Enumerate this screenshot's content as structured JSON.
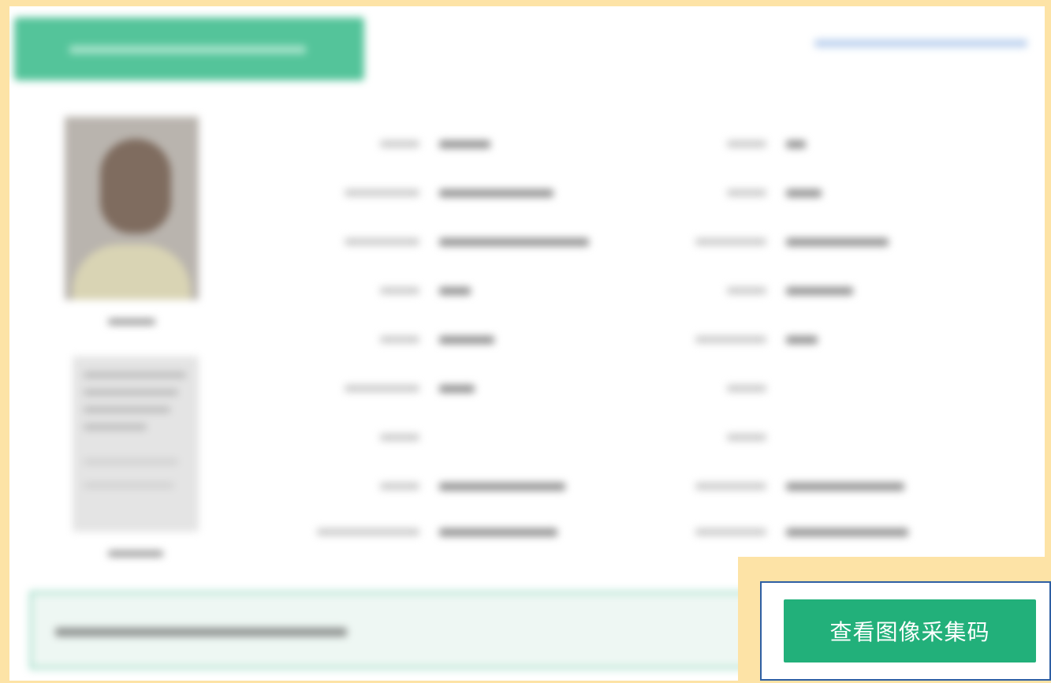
{
  "colors": {
    "page_background": "#fde3a6",
    "header_tab": "#54c49a",
    "primary_button": "#22b07a",
    "notice_border": "#5cc49a",
    "highlight_frame": "#2e5fa3"
  },
  "profile": {
    "photo_icon": "person-photo-icon",
    "document_icon": "document-thumbnail-icon"
  },
  "action": {
    "view_image_code_label": "查看图像采集码"
  }
}
